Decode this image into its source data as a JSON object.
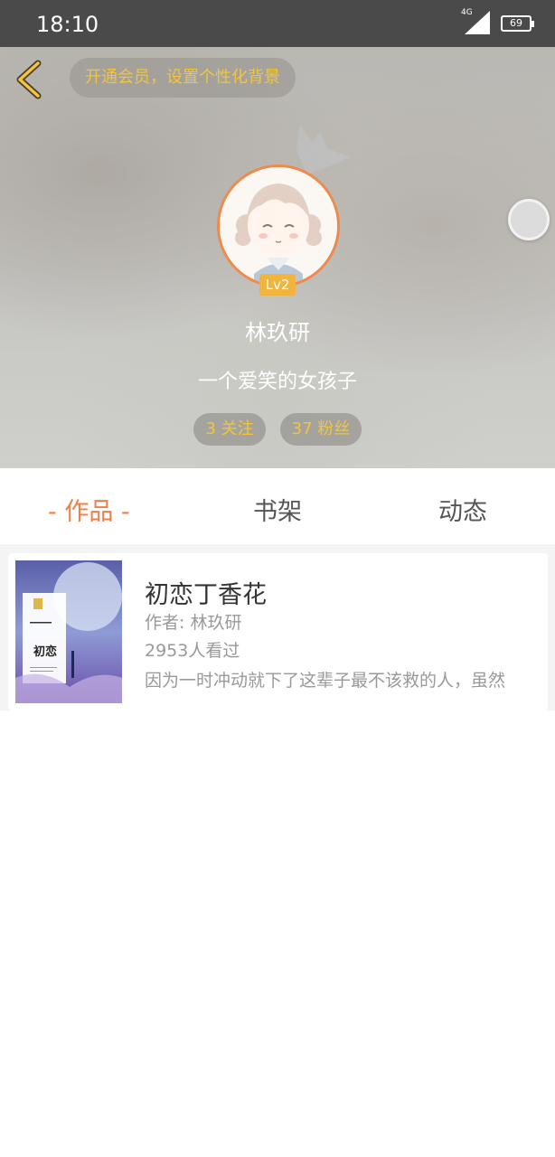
{
  "status_bar": {
    "time": "18:10",
    "network": "4G",
    "battery": "69"
  },
  "header": {
    "vip_banner": "开通会员，设置个性化背景",
    "level": "Lv2",
    "username": "林玖研",
    "bio": "一个爱笑的女孩子",
    "following": "3 关注",
    "followers": "37 粉丝",
    "accent_color": "#f2c53d",
    "avatar_ring_color": "#f08a4b"
  },
  "tabs": [
    {
      "label": "- 作品 -",
      "active": true
    },
    {
      "label": "书架",
      "active": false
    },
    {
      "label": "动态",
      "active": false
    }
  ],
  "books": [
    {
      "title": "初恋丁香花",
      "author": "作者: 林玖研",
      "views": "2953人看过",
      "description": "因为一时冲动就下了这辈子最不该救的人，虽然",
      "cover_title": "初恋"
    }
  ],
  "icons": {
    "back": "chevron-left-icon",
    "crown": "crown-icon"
  }
}
